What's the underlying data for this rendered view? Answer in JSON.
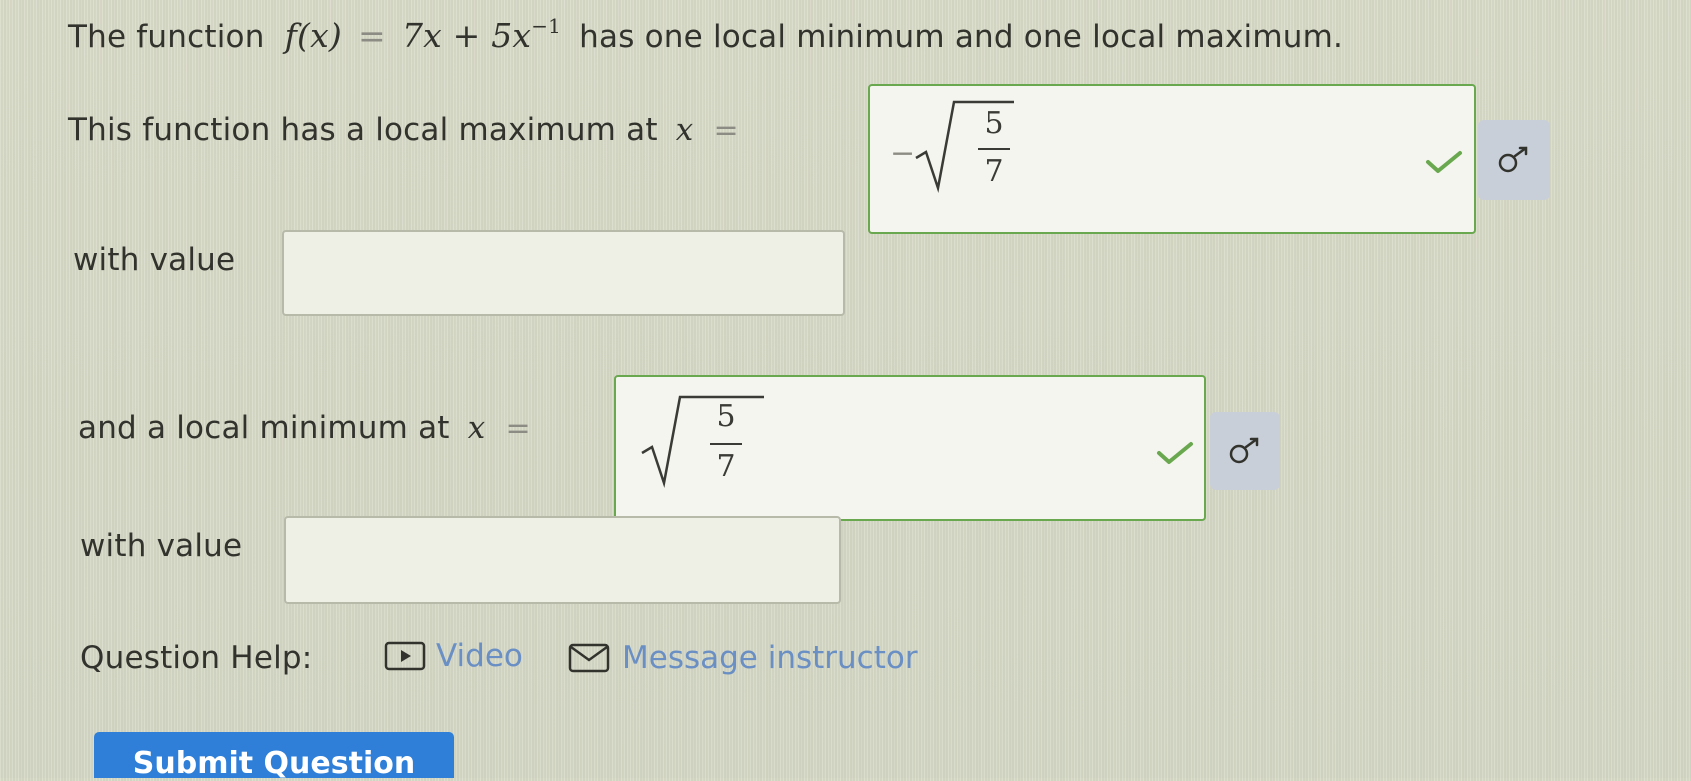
{
  "question": {
    "intro_before": "The function",
    "function_lhs": "f(x)",
    "function_eq": "=",
    "function_rhs": "7x + 5x",
    "function_exp": "−1",
    "intro_after": "has one local minimum and one local maximum."
  },
  "local_max": {
    "label": "This function has a local maximum at",
    "variable": "x",
    "eq": "=",
    "answer_sign": "−",
    "answer_num": "5",
    "answer_den": "7",
    "status": "correct",
    "value_label": "with value",
    "value_input": ""
  },
  "local_min": {
    "label": "and a local minimum at",
    "variable": "x",
    "eq": "=",
    "answer_num": "5",
    "answer_den": "7",
    "status": "correct",
    "value_label": "with value",
    "value_input": ""
  },
  "help": {
    "label": "Question Help:",
    "video": "Video",
    "message": "Message instructor"
  },
  "submit": {
    "label": "Submit Question"
  },
  "icons": {
    "check": "check-icon",
    "preview": "preview-icon",
    "video": "video-icon",
    "mail": "mail-icon"
  },
  "colors": {
    "correct": "#6aa84f",
    "link": "#6a8fc4",
    "submit": "#2f7fd8"
  }
}
